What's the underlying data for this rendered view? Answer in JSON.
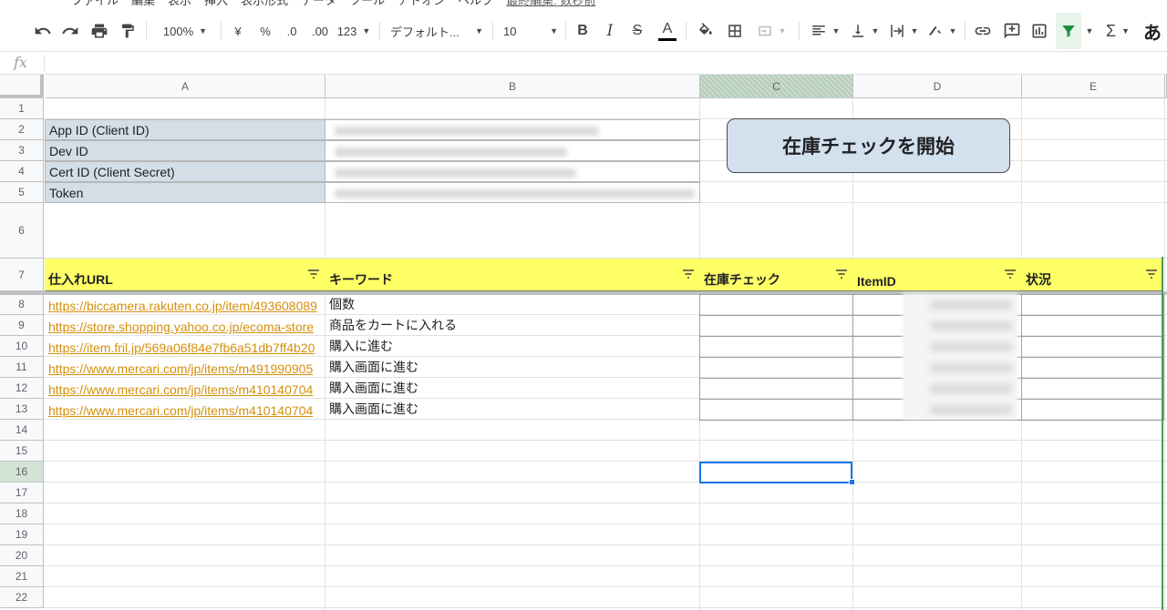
{
  "menu": {
    "items": [
      "ファイル",
      "編集",
      "表示",
      "挿入",
      "表示形式",
      "データ",
      "ツール",
      "アドオン",
      "ヘルプ"
    ],
    "last_edit": "最終編集: 数秒前"
  },
  "toolbar": {
    "zoom": "100%",
    "currency": "¥",
    "percent": "%",
    "decimal_decrease": ".0",
    "decimal_increase": ".00",
    "number_format": "123",
    "font": "デフォルト...",
    "font_size": "10",
    "sigma": "Σ",
    "input_tool": "あ"
  },
  "formula_bar": {
    "fx": "fx",
    "value": ""
  },
  "columns": [
    "A",
    "B",
    "C",
    "D",
    "E"
  ],
  "rows": [
    "1",
    "2",
    "3",
    "4",
    "5",
    "6",
    "7",
    "8",
    "9",
    "10",
    "11",
    "12",
    "13",
    "14",
    "15",
    "16",
    "17",
    "18",
    "19",
    "20",
    "21",
    "22"
  ],
  "credentials": {
    "labels": [
      "App ID (Client ID)",
      "Dev ID",
      "Cert ID (Client Secret)",
      "Token"
    ]
  },
  "start_button": "在庫チェックを開始",
  "table": {
    "headers": [
      "仕入れURL",
      "キーワード",
      "在庫チェック",
      "ItemID",
      "状況"
    ],
    "rows": [
      {
        "url": "https://biccamera.rakuten.co.jp/item/493608089",
        "keyword": "個数"
      },
      {
        "url": "https://store.shopping.yahoo.co.jp/ecoma-store",
        "keyword": "商品をカートに入れる"
      },
      {
        "url": "https://item.fril.jp/569a06f84e7fb6a51db7ff4b20",
        "keyword": "購入に進む"
      },
      {
        "url": "https://www.mercari.com/jp/items/m491990905",
        "keyword": "購入画面に進む"
      },
      {
        "url": "https://www.mercari.com/jp/items/m410140704",
        "keyword": "購入画面に進む"
      },
      {
        "url": "https://www.mercari.com/jp/items/m410140704",
        "keyword": "購入画面に進む"
      }
    ]
  },
  "colors": {
    "header_yellow": "#ffff66",
    "label_blue": "#d3dee6",
    "button_blue": "#d3e0ee",
    "link": "#d4900b",
    "selection": "#1a73e8"
  },
  "selected_cell": "C16"
}
